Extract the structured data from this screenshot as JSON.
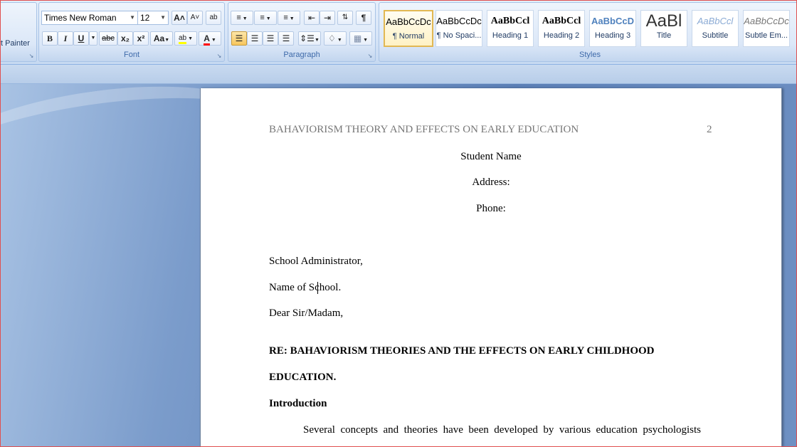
{
  "clipboard": {
    "painter_label": "t Painter"
  },
  "font_group": {
    "label": "Font",
    "font_name": "Times New Roman",
    "font_size": "12",
    "grow_glyph": "A˄",
    "shrink_glyph": "A˅",
    "clear_glyph": "ab",
    "bold": "B",
    "italic": "I",
    "underline": "U",
    "strikethrough": "abc",
    "subscript": "x₂",
    "superscript": "x²",
    "change_case": "Aa",
    "highlight": "ab",
    "font_color": "A",
    "highlight_color": "#ffff00",
    "font_color_value": "#ff0000"
  },
  "paragraph_group": {
    "label": "Paragraph",
    "pilcrow": "¶"
  },
  "styles_group": {
    "label": "Styles",
    "items": [
      {
        "sample": "AaBbCcDc",
        "name": "¶ Normal"
      },
      {
        "sample": "AaBbCcDc",
        "name": "¶ No Spaci..."
      },
      {
        "sample": "AaBbCcl",
        "name": "Heading 1"
      },
      {
        "sample": "AaBbCcl",
        "name": "Heading 2"
      },
      {
        "sample": "AaBbCcD",
        "name": "Heading 3"
      },
      {
        "sample": "AaBl",
        "name": "Title"
      },
      {
        "sample": "AaBbCcl",
        "name": "Subtitle"
      },
      {
        "sample": "AaBbCcDc",
        "name": "Subtle Em..."
      }
    ]
  },
  "document": {
    "header_title": "BAHAVIORISM THEORY AND EFFECTS ON EARLY EDUCATION",
    "page_number": "2",
    "student_name": "Student Name",
    "address": "Address:",
    "phone": "Phone:",
    "recipient": "School Administrator,",
    "school": "Name of School.",
    "salutation": "Dear Sir/Madam,",
    "re_line1": "RE: BAHAVIORISM THEORIES AND THE EFFECTS ON EARLY CHILDHOOD",
    "re_line2": "EDUCATION.",
    "intro_heading": "Introduction",
    "body_start": "Several  concepts  and  theories  have  been  developed  by  various  education  psychologists"
  }
}
